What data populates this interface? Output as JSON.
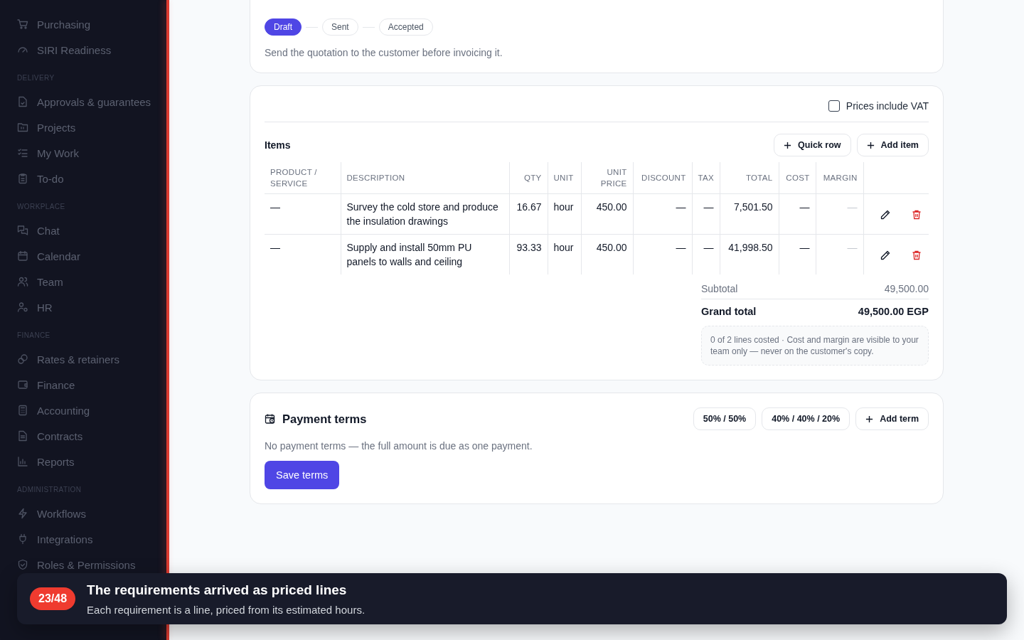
{
  "sidebar": {
    "sections": [
      {
        "items": [
          {
            "label": "Purchasing"
          },
          {
            "label": "SIRI Readiness"
          }
        ]
      },
      {
        "label": "DELIVERY",
        "items": [
          {
            "label": "Approvals & guarantees"
          },
          {
            "label": "Projects"
          },
          {
            "label": "My Work"
          },
          {
            "label": "To-do"
          }
        ]
      },
      {
        "label": "WORKPLACE",
        "items": [
          {
            "label": "Chat"
          },
          {
            "label": "Calendar"
          },
          {
            "label": "Team"
          },
          {
            "label": "HR"
          }
        ]
      },
      {
        "label": "FINANCE",
        "items": [
          {
            "label": "Rates & retainers"
          },
          {
            "label": "Finance"
          },
          {
            "label": "Accounting"
          },
          {
            "label": "Contracts"
          },
          {
            "label": "Reports"
          }
        ]
      },
      {
        "label": "ADMINISTRATION",
        "items": [
          {
            "label": "Workflows"
          },
          {
            "label": "Integrations"
          },
          {
            "label": "Roles & Permissions"
          }
        ]
      }
    ]
  },
  "status_card": {
    "steps": [
      {
        "label": "Draft",
        "selected": true
      },
      {
        "label": "Sent",
        "selected": false
      },
      {
        "label": "Accepted",
        "selected": false
      }
    ],
    "hint": "Send the quotation to the customer before invoicing it."
  },
  "items_card": {
    "vat": {
      "label": "Prices include VAT",
      "checked": false
    },
    "title": "Items",
    "buttons": [
      "Quick row",
      "Add item"
    ],
    "columns": [
      "PRODUCT / SERVICE",
      "DESCRIPTION",
      "QTY",
      "UNIT",
      "UNIT PRICE",
      "DISCOUNT",
      "TAX",
      "TOTAL",
      "COST",
      "MARGIN"
    ],
    "rows": [
      {
        "cells": [
          "—",
          "Survey the cold store and produce the insulation drawings",
          "16.67",
          "hour",
          "450.00",
          "—",
          "—",
          "7,501.50",
          "—",
          "—"
        ]
      },
      {
        "cells": [
          "—",
          "Supply and install 50mm PU panels to walls and ceiling",
          "93.33",
          "hour",
          "450.00",
          "—",
          "—",
          "41,998.50",
          "—",
          "—"
        ]
      }
    ],
    "subtotal": {
      "label": "Subtotal",
      "value": "49,500.00"
    },
    "grand_total": {
      "label": "Grand total",
      "value": "49,500.00 EGP"
    },
    "note": "0 of 2 lines costed · Cost and margin are visible to your team only — never on the customer's copy."
  },
  "payment_card": {
    "title": "Payment terms",
    "presets": [
      "50% / 50%",
      "40% / 40% / 20%"
    ],
    "add": "Add term",
    "hint": "No payment terms — the full amount is due as one payment.",
    "save": "Save terms"
  },
  "toast": {
    "badge": "23/48",
    "title": "The requirements arrived as priced lines",
    "text": "Each requirement is a line, priced from its estimated hours."
  }
}
